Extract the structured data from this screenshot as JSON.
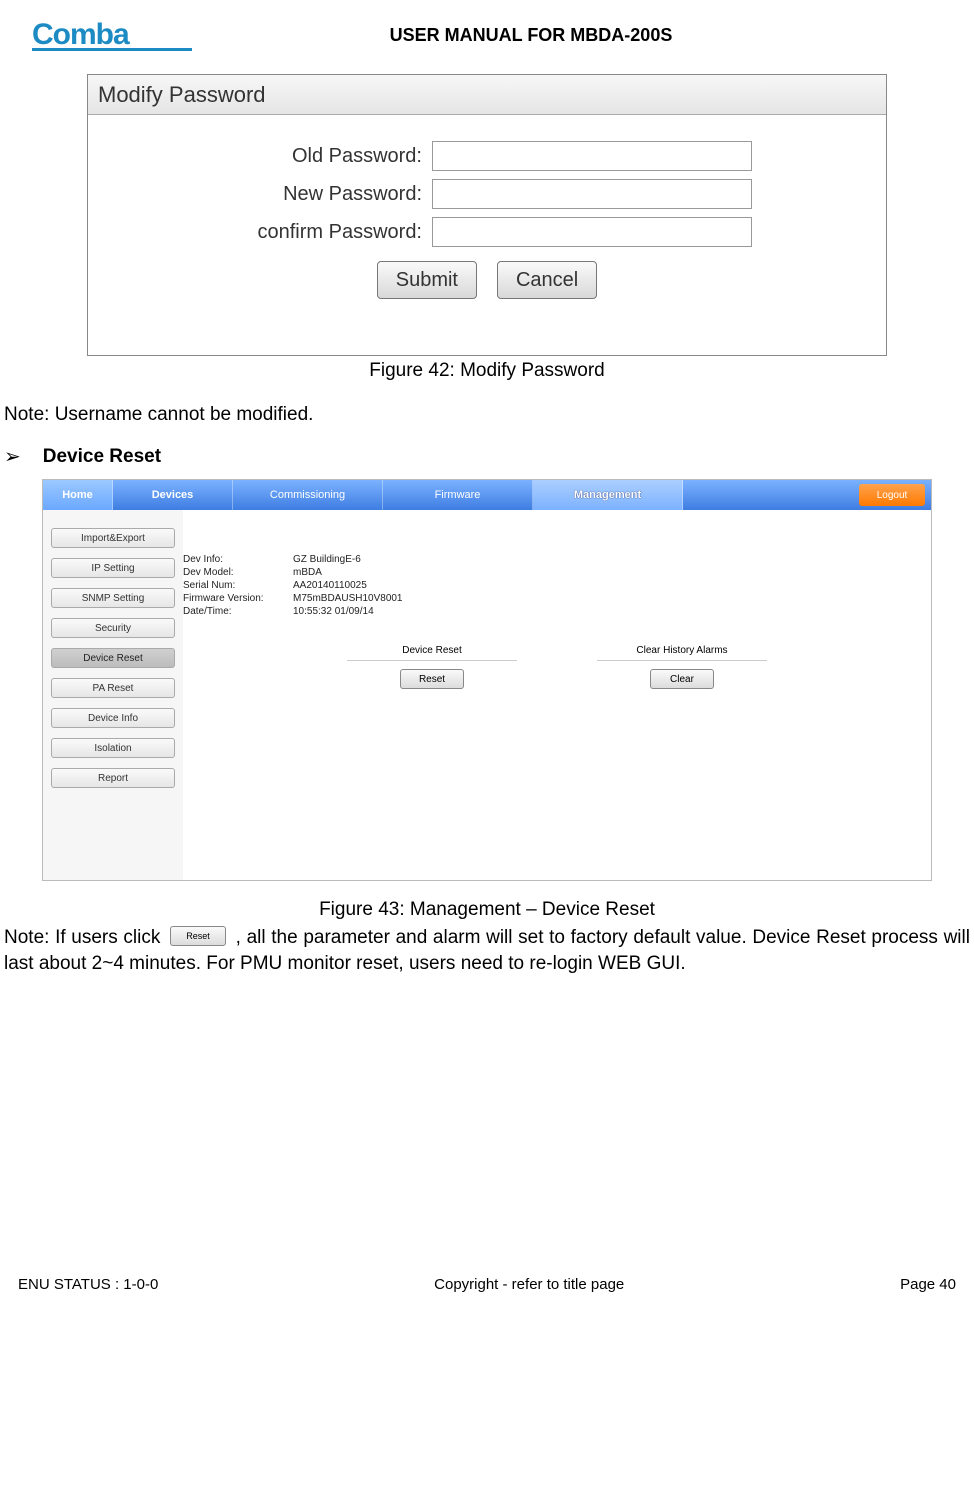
{
  "doc_title": "USER MANUAL FOR MBDA-200S",
  "fig42": {
    "title": "Modify Password",
    "rows": [
      {
        "label": "Old Password:"
      },
      {
        "label": "New Password:"
      },
      {
        "label": "confirm Password:"
      }
    ],
    "submit": "Submit",
    "cancel": "Cancel",
    "caption": "Figure 42: Modify Password"
  },
  "note_username": "Note: Username cannot be modified.",
  "bullet": {
    "symbol": "➢",
    "text": "Device Reset"
  },
  "fig43": {
    "nav": {
      "home": "Home",
      "devices": "Devices",
      "commissioning": "Commissioning",
      "firmware": "Firmware",
      "management": "Management",
      "logout": "Logout"
    },
    "sidebar": [
      {
        "label": "Import&Export",
        "active": false
      },
      {
        "label": "IP Setting",
        "active": false
      },
      {
        "label": "SNMP Setting",
        "active": false
      },
      {
        "label": "Security",
        "active": false
      },
      {
        "label": "Device Reset",
        "active": true
      },
      {
        "label": "PA Reset",
        "active": false
      },
      {
        "label": "Device Info",
        "active": false
      },
      {
        "label": "Isolation",
        "active": false
      },
      {
        "label": "Report",
        "active": false
      }
    ],
    "info": [
      {
        "k": "Dev Info:",
        "v": "GZ BuildingE-6"
      },
      {
        "k": "Dev Model:",
        "v": "mBDA"
      },
      {
        "k": "Serial Num:",
        "v": "AA20140110025"
      },
      {
        "k": "Firmware Version:",
        "v": "M75mBDAUSH10V8001"
      },
      {
        "k": "Date/Time:",
        "v": "10:55:32 01/09/14"
      }
    ],
    "reset": {
      "head": "Device Reset",
      "btn": "Reset"
    },
    "clear": {
      "head": "Clear History Alarms",
      "btn": "Clear"
    },
    "caption": "Figure 43: Management – Device Reset"
  },
  "note2": {
    "pre": "Note: If users click ",
    "btn": "Reset",
    "post1": ", all the parameter and alarm will set to factory default value. Device Reset ",
    "post2": "process will last about 2~4 minutes. For PMU monitor reset, users need to re-login WEB GUI."
  },
  "footer": {
    "left": "ENU STATUS : 1-0-0",
    "center": "Copyright - refer to title page",
    "right": "Page 40"
  }
}
